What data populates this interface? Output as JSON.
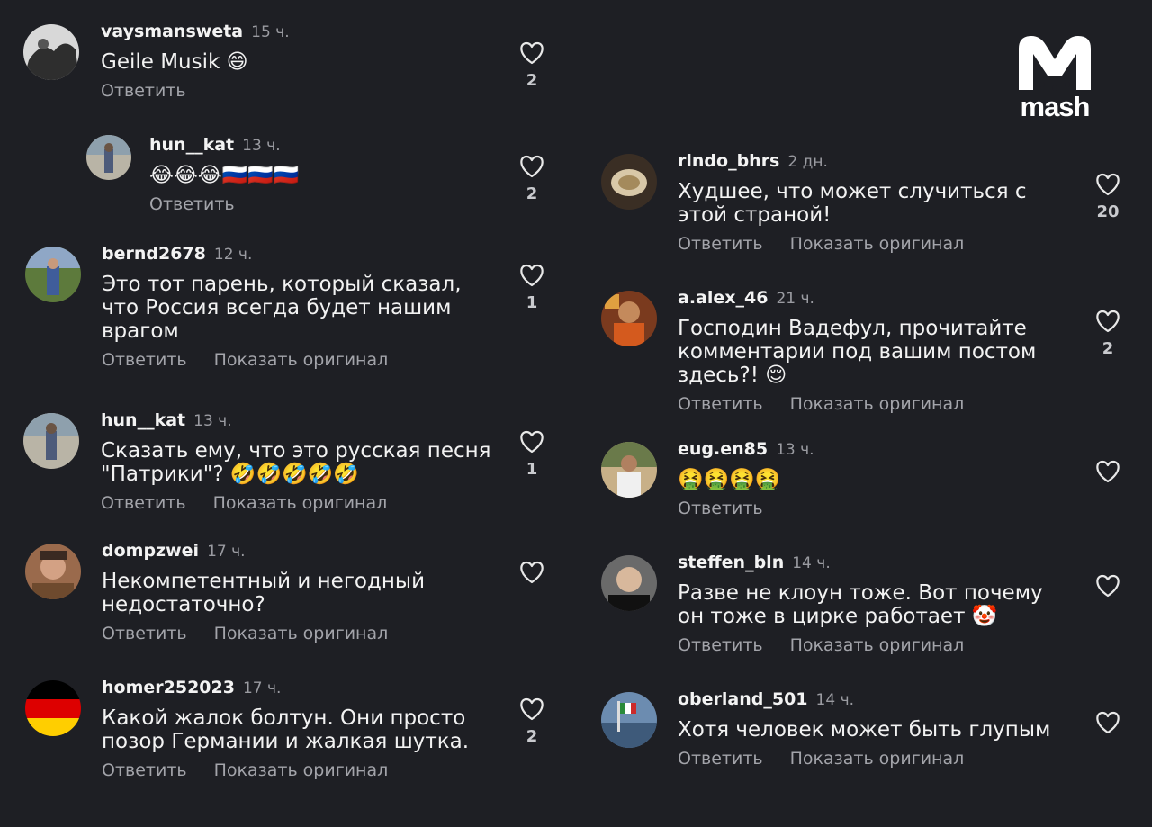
{
  "brand": {
    "logo_text": "mash"
  },
  "actions": {
    "reply": "Ответить",
    "show_original": "Показать оригинал"
  },
  "comments": [
    {
      "username": "vaysmansweta",
      "time": "15 ч.",
      "text": "Geile Musik 😄",
      "likes": "2"
    },
    {
      "username": "hun__kat",
      "time": "13 ч.",
      "text": "😂😂😂🇷🇺🇷🇺🇷🇺",
      "likes": "2"
    },
    {
      "username": "bernd2678",
      "time": "12 ч.",
      "text": "Это тот парень, который сказал, что Россия всегда будет нашим врагом",
      "likes": "1"
    },
    {
      "username": "hun__kat",
      "time": "13 ч.",
      "text": "Сказать ему, что это русская песня \"Патрики\"? 🤣🤣🤣🤣🤣",
      "likes": "1"
    },
    {
      "username": "dompzwei",
      "time": "17 ч.",
      "text": "Некомпетентный и негодный недостаточно?",
      "likes": ""
    },
    {
      "username": "homer252023",
      "time": "17 ч.",
      "text": "Какой жалок болтун. Они просто позор Германии и жалкая шутка.",
      "likes": "2"
    },
    {
      "username": "rlndo_bhrs",
      "time": "2 дн.",
      "text": "Худшее, что может случиться с этой страной!",
      "likes": "20"
    },
    {
      "username": "a.alex_46",
      "time": "21 ч.",
      "text": "Господин Вадефул, прочитайте комментарии под вашим постом здесь?! 😌",
      "likes": "2"
    },
    {
      "username": "eug.en85",
      "time": "13 ч.",
      "text": "🤮🤮🤮🤮",
      "likes": ""
    },
    {
      "username": "steffen_bln",
      "time": "14 ч.",
      "text": "Разве не клоун тоже. Вот почему он тоже в цирке работает 🤡",
      "likes": ""
    },
    {
      "username": "oberland_501",
      "time": "14 ч.",
      "text": "Хотя человек может быть глупым",
      "likes": ""
    }
  ]
}
